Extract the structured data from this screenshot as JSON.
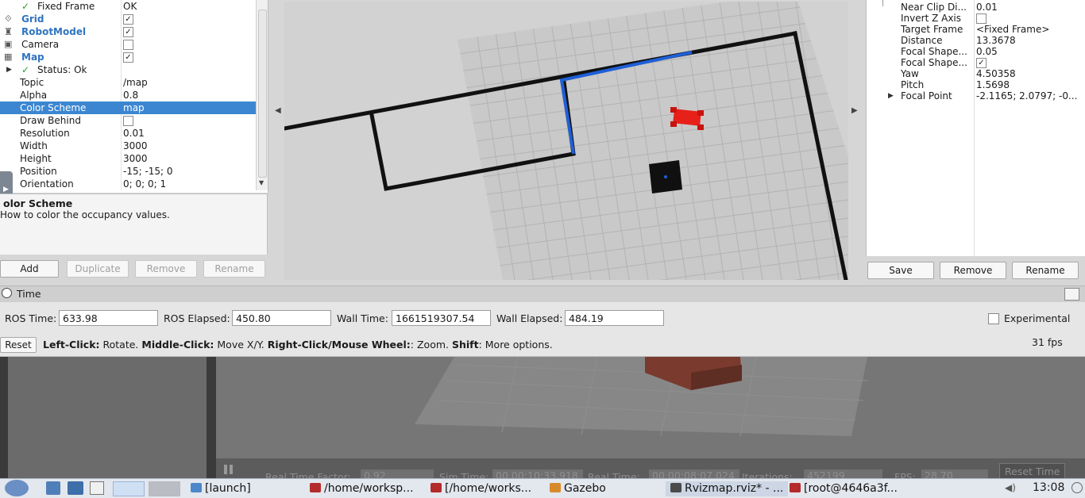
{
  "displays": {
    "rows": [
      {
        "name": "Fixed Frame",
        "value": "OK"
      },
      {
        "name": "Grid"
      },
      {
        "name": "RobotModel"
      },
      {
        "name": "Camera"
      },
      {
        "name": "Map"
      },
      {
        "name": "Status: Ok"
      },
      {
        "name": "Topic",
        "value": "/map"
      },
      {
        "name": "Alpha",
        "value": "0.8"
      },
      {
        "name": "Color Scheme",
        "value": "map"
      },
      {
        "name": "Draw Behind"
      },
      {
        "name": "Resolution",
        "value": "0.01"
      },
      {
        "name": "Width",
        "value": "3000"
      },
      {
        "name": "Height",
        "value": "3000"
      },
      {
        "name": "Position",
        "value": "-15; -15; 0"
      },
      {
        "name": "Orientation",
        "value": "0; 0; 0; 1"
      }
    ]
  },
  "description": {
    "title": "olor Scheme",
    "text": "How to color the occupancy values."
  },
  "display_buttons": {
    "add": "Add",
    "duplicate": "Duplicate",
    "remove": "Remove",
    "rename": "Rename"
  },
  "views": {
    "rows": [
      {
        "name": "Near Clip Di...",
        "value": "0.01"
      },
      {
        "name": "Invert Z Axis"
      },
      {
        "name": "Target Frame",
        "value": "<Fixed Frame>"
      },
      {
        "name": "Distance",
        "value": "13.3678"
      },
      {
        "name": "Focal Shape...",
        "value": "0.05"
      },
      {
        "name": "Focal Shape..."
      },
      {
        "name": "Yaw",
        "value": "4.50358"
      },
      {
        "name": "Pitch",
        "value": "1.5698"
      },
      {
        "name": "Focal Point",
        "value": "-2.1165; 2.0797; -0..."
      }
    ],
    "save": "Save",
    "remove": "Remove",
    "rename": "Rename"
  },
  "time": {
    "title": "Time",
    "ros_time_label": "ROS Time:",
    "ros_time": "633.98",
    "ros_elapsed_label": "ROS Elapsed:",
    "ros_elapsed": "450.80",
    "wall_time_label": "Wall Time:",
    "wall_time": "1661519307.54",
    "wall_elapsed_label": "Wall Elapsed:",
    "wall_elapsed": "484.19",
    "experimental": "Experimental"
  },
  "status": {
    "reset": "Reset",
    "h1": "Left-Click:",
    "t1": " Rotate. ",
    "h2": "Middle-Click:",
    "t2": " Move X/Y. ",
    "h3": "Right-Click/Mouse Wheel:",
    "t3": ": Zoom. ",
    "h4": "Shift",
    "t4": ": More options.",
    "fps": "31 fps"
  },
  "gazebo": {
    "real_time_factor_label": "Real Time Factor:",
    "real_time_factor": "0.92",
    "sim_time_label": "Sim Time:",
    "sim_time": "00 00:10:33.918",
    "real_time_label": "Real Time:",
    "real_time": "00 00:08:07.024",
    "iterations_label": "Iterations:",
    "iterations": "452199",
    "fps_label": "FPS:",
    "fps": "28.70",
    "reset_time": "Reset Time"
  },
  "taskbar": {
    "items": [
      "[launch]",
      "/home/worksp...",
      "[/home/works...",
      "Gazebo",
      "Rvizmap.rviz* - ...",
      "[root@4646a3f..."
    ],
    "clock": "13:08"
  },
  "colors": {
    "selection": "#3c86d1",
    "path_blue": "#1f5fd6",
    "robot_red": "#e8201a"
  }
}
